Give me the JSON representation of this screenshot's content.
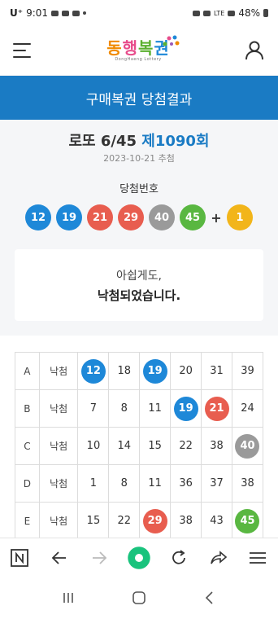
{
  "status": {
    "carrier": "U⁺",
    "time": "9:01",
    "network": "LTE",
    "battery": "48%"
  },
  "header": {
    "logo_chars": [
      "동",
      "행",
      "복",
      "권"
    ],
    "logo_sub": "DongHaeng Lottery"
  },
  "page_title": "구매복권 당첨결과",
  "draw": {
    "game": "로또 6/45",
    "round": "제1090회",
    "date": "2023-10-21 추첨",
    "winning_label": "당첨번호",
    "winning_numbers": [
      "12",
      "19",
      "21",
      "29",
      "40",
      "45"
    ],
    "bonus_number": "1",
    "plus": "+"
  },
  "result": {
    "line1": "아쉽게도,",
    "line2": "낙첨되었습니다."
  },
  "tickets": [
    {
      "game": "A",
      "status": "낙첨",
      "numbers": [
        "12",
        "18",
        "19",
        "20",
        "31",
        "39"
      ]
    },
    {
      "game": "B",
      "status": "낙첨",
      "numbers": [
        "7",
        "8",
        "11",
        "19",
        "21",
        "24"
      ]
    },
    {
      "game": "C",
      "status": "낙첨",
      "numbers": [
        "10",
        "14",
        "15",
        "22",
        "38",
        "40"
      ]
    },
    {
      "game": "D",
      "status": "낙첨",
      "numbers": [
        "1",
        "8",
        "11",
        "36",
        "37",
        "38"
      ]
    },
    {
      "game": "E",
      "status": "낙첨",
      "numbers": [
        "15",
        "22",
        "29",
        "38",
        "43",
        "45"
      ]
    }
  ],
  "colors": {
    "brand_blue": "#1a7bc4",
    "ball_yellow": "#f2b51a",
    "ball_blue": "#1e88d8",
    "ball_red": "#e85d4f",
    "ball_gray": "#9a9a9a",
    "ball_green": "#59b741"
  },
  "icons": {
    "menu": "hamburger-icon",
    "user": "user-icon",
    "toolbar": [
      "naver-n-icon",
      "back-arrow-icon",
      "forward-arrow-icon",
      "green-circle-icon",
      "refresh-icon",
      "share-icon",
      "menu-lines-icon"
    ],
    "nav": [
      "recents-icon",
      "home-icon",
      "back-icon"
    ]
  }
}
